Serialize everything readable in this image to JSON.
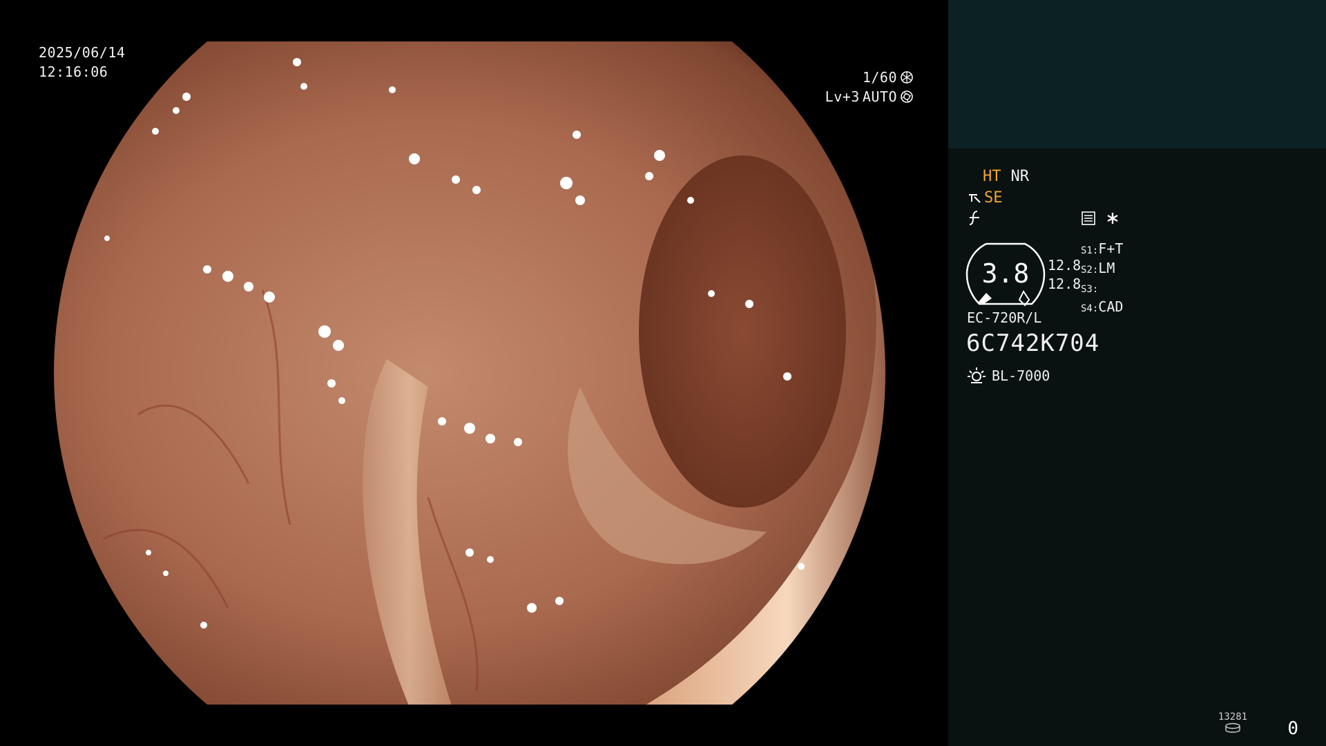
{
  "osd": {
    "date": "2025/06/14",
    "time": "12:16:06",
    "shutter": "1/60",
    "iris_level": "Lv+3",
    "iris_mode": "AUTO"
  },
  "panel": {
    "ht": "HT",
    "nr": "NR",
    "se": "SE",
    "scope_value": "3.8",
    "num_top": "12.8",
    "num_bottom": "12.8",
    "slots": [
      {
        "label": "S1:",
        "value": "F+T"
      },
      {
        "label": "S2:",
        "value": "LM"
      },
      {
        "label": "S3:",
        "value": ""
      },
      {
        "label": "S4:",
        "value": "CAD"
      }
    ],
    "model": "EC-720R/L",
    "serial": "6C742K704",
    "light_source": "BL-7000",
    "counter": "13281",
    "zero": "0"
  },
  "colors": {
    "panel_bg": "#0a1111",
    "panel_top_bg": "#0c2123",
    "accent_orange": "#f2a533"
  },
  "icons": [
    "shutter-icon",
    "iris-icon",
    "scope-tip-icon",
    "filter-icon",
    "settings-icon",
    "asterisk-icon",
    "gauge-icon",
    "light-source-icon",
    "storage-icon"
  ]
}
